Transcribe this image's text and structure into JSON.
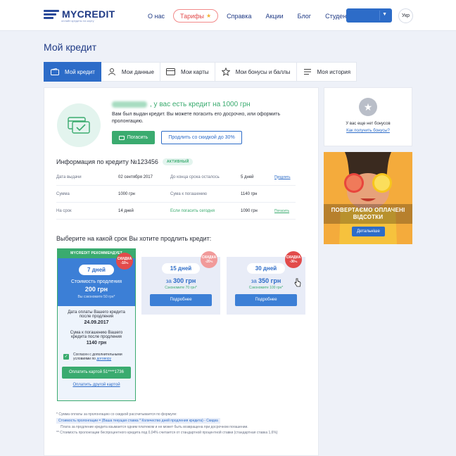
{
  "header": {
    "logo": "MYCREDIT",
    "logo_tagline": "онлайн кредиты на карту",
    "nav": [
      "О нас",
      "Тарифы",
      "Справка",
      "Акции",
      "Блог",
      "Студентам"
    ],
    "lang": "Укр"
  },
  "page_title": "Мой кредит",
  "tabs": [
    "Мой кредит",
    "Мои данные",
    "Мои карты",
    "Мои бонусы и баллы",
    "Моя история"
  ],
  "hero": {
    "greeting": ", у вас есть кредит на 1000 грн",
    "text": "Вам был выдан кредит. Вы можете погасить его досрочно, или оформить пролонгацию.",
    "pay_button": "Погасить",
    "extend_button": "Продлить со скидкой до 30%"
  },
  "info": {
    "title": "Информация по кредиту №123456",
    "badge": "АКТИВНЫЙ",
    "rows": [
      {
        "label": "Дата выдачи",
        "value": "02 сентября 2017",
        "label2": "До конца срока осталось",
        "value2": "5 дней",
        "link": "Продлить"
      },
      {
        "label": "Сумма",
        "value": "1000 грн",
        "label2": "Сума к погашению",
        "value2": "1140 грн",
        "link": ""
      },
      {
        "label": "На срок",
        "value": "14 дней",
        "label2": "Если погасить сегодня",
        "value2": "1090 грн",
        "link": "Погасить"
      }
    ]
  },
  "choose_title": "Выберите на какой срок Вы хотите продлить кредит:",
  "offer_main": {
    "recommended": "MYCREDIT РЕКОММЕНДУЕТ",
    "discount_label": "СКИДКА",
    "discount": "-10",
    "days": "7 дней",
    "cost_label": "Стоимость продления",
    "cost": "200 грн",
    "saved": "Вы сэкономите 50 грн*",
    "pay_date_label": "Дата оплаты Вашего кредита после продления",
    "pay_date": "24.09.2017",
    "repay_label": "Сума к погашению Вашего кредита после продления",
    "repay": "1140 грн",
    "agree_text": "Согласен с дополнительными условиями по",
    "agree_link": "договору",
    "pay_card": "Оплатить картой 51****1736",
    "pay_other": "Оплатить другой картой"
  },
  "offers": [
    {
      "days": "15 дней",
      "price_prefix": "за",
      "price": "300 грн",
      "saved": "Сэкономите 70 грн*",
      "discount_label": "СКИДКА",
      "discount": "-20",
      "more": "Подробнее"
    },
    {
      "days": "30 дней",
      "price_prefix": "за",
      "price": "350 грн",
      "saved": "Сэкономите 100 грн*",
      "discount_label": "СКИДКА",
      "discount": "-30",
      "more": "Подробнее"
    }
  ],
  "footnotes": {
    "f1": "* Сумма оплаты за пролонгацию со скидкой рассчитывается по формуле:",
    "formula": "Стоимость пролонгации = (Ваша текущая ставка * Количество дней продления кредита) - Скидка",
    "f2": "Плата за продление кредита взымается одним платежом и не может быть возвращена при досрочном погашении.",
    "f3": "** Стоимость пролонгации беспроцентного кредита под 0,04% считается от стандартной процентной ставки (стандартная ставка 1,6%)"
  },
  "bonus": {
    "text": "У вас еще нет бонусов",
    "link": "Как получить бонусы?"
  },
  "promo": {
    "text": "ПОВЕРТАЄМО ОПЛАЧЕНІ ВІДСОТКИ",
    "button": "Детальніше"
  },
  "colors": {
    "brand": "#1f3a85",
    "primary": "#2d6cc8",
    "green": "#3aab6f",
    "discount_red": "#e24b4b",
    "page_bg": "#eef1f8"
  }
}
